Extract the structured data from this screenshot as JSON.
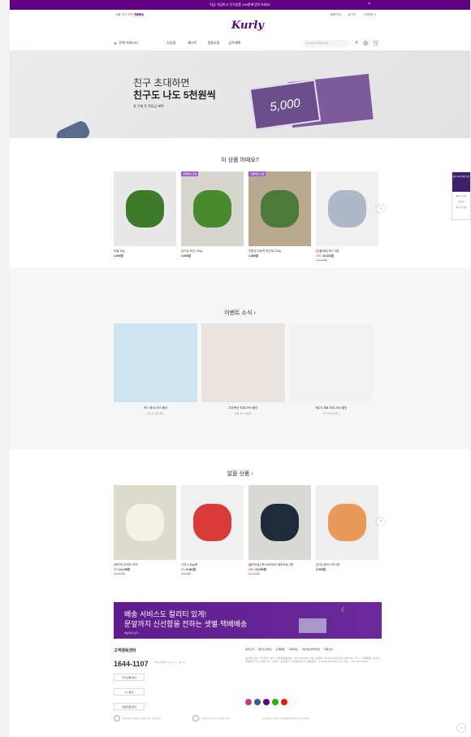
{
  "topbar": {
    "text": "지금 가입하고 인기상품 100원에 받아가세요!",
    "close": "×"
  },
  "util": {
    "delivery_prefix": "서울·경기 지역",
    "delivery_link": "샛별배송",
    "links": [
      "회원가입",
      "로그인",
      "고객센터 ▾"
    ]
  },
  "logo": "Kurly",
  "gnb": {
    "category_label": "전체 카테고리",
    "menu": [
      "신상품",
      "베스트",
      "알뜰쇼핑",
      "금주혜택"
    ],
    "search_placeholder": "검색어를 입력해주세요"
  },
  "hero": {
    "line1": "친구 초대하면",
    "line2": "친구도 나도 5천원씩",
    "line3": "첫 구매 후 적립금 혜택",
    "card_value": "5,000"
  },
  "section_recommend": {
    "title": "이 상품 어때요?",
    "products": [
      {
        "name": "바질 10g",
        "price": "1,800원",
        "badge": "",
        "discount": "",
        "original": "",
        "color": "#e8e8e8",
        "leaf": "#3f7a2a"
      },
      {
        "name": "유기농 쑥갓 100g",
        "price": "2,900원",
        "badge": "샛별배송 전용",
        "discount": "",
        "original": "",
        "color": "#d6d6cf",
        "leaf": "#4a8a2f"
      },
      {
        "name": "친환경 무농약 적근대 100g",
        "price": "1,800원",
        "badge": "샛별배송 전용",
        "discount": "",
        "original": "",
        "color": "#b9a98f",
        "leaf": "#4c7a3a"
      },
      {
        "name": "[선물세트] 푸드 3종",
        "price": "16,320원",
        "badge": "",
        "discount": "20%",
        "original": "20,400원",
        "color": "#f0f0f0",
        "leaf": "#b0b7c8"
      }
    ],
    "next": "›"
  },
  "section_event": {
    "title": "이벤트 소식 ›",
    "events": [
      {
        "name": "박스 최대 15% 할인",
        "sub": "이번 주 한정 특가",
        "color": "#cfe3f0"
      },
      {
        "name": "우리축산 최대 25% 할인",
        "sub": "정육 특가 이벤트",
        "color": "#e9e4df"
      },
      {
        "name": "이유식 재료 최대 25% 할인",
        "sub": "아기 이유식 특가",
        "color": "#f2f2f2"
      }
    ]
  },
  "section_deal": {
    "title": "알뜰 상품 ›",
    "products": [
      {
        "name": "[케이브] 무라타 치즈",
        "price": "14,155원",
        "badge": "",
        "discount": "5%",
        "original": "14,900원",
        "color": "#dcdccd",
        "leaf": "#f4f1e6"
      },
      {
        "name": "사과 1.2kg/봉",
        "price": "9,461원",
        "badge": "",
        "discount": "3%",
        "original": "9,900원",
        "color": "#f0f0f0",
        "leaf": "#d93a3a"
      },
      {
        "name": "[올리브유] 엑스트라버진 올리브유 2종",
        "price": "15,350원",
        "badge": "",
        "discount": "39%",
        "original": "25,000원",
        "color": "#d8d8d4",
        "leaf": "#1f2a3a"
      },
      {
        "name": "[간식] 현미 스틱 2종",
        "price": "3,900원",
        "badge": "",
        "discount": "",
        "original": "",
        "color": "#eeeeee",
        "leaf": "#e89a5a"
      }
    ],
    "next": "›"
  },
  "banner": {
    "line1": "배송 서비스도 컬리티 있게!",
    "line2": "문앞까지 신선함을 전하는 샛별·택배배송",
    "link": "배송안내 보기"
  },
  "footer": {
    "cs_title": "고객행복센터",
    "phone": "1644-1107",
    "cs_hours": "365고객센터 오전 7시 - 오후 7시",
    "buttons": [
      "카카오톡 문의",
      "1:1 문의",
      "대량주문 문의"
    ],
    "links": [
      "컬리소개",
      "컬리소개영상",
      "인재채용",
      "이용약관",
      "개인정보처리방침",
      "이용안내"
    ],
    "info": "법인명(상호) : 주식회사 컬리 | 사업자등록번호 : 261-81-23567 | 통신판매업 : 제 2018-서울강남-01646 호 | 주소 : 서울특별시 강남구 테헤란로 133 | 대표이사 : 김슬아 | 입점문의 : 입점문의하기 | 채용문의 : recruit@kurlycorp.com | 팩스 : 070-7500-6098"
  },
  "certs": [
    "[인증범위] 마켓컬리 쇼핑몰 서비스 개발·운영",
    "개인정보보호 우수 웹사이트 인증",
    "payments 고객님은 안전거래를 위해 현금 등으로 결제시"
  ],
  "sticky": {
    "top": "컬리 최대 혜택 모음",
    "items": [
      "배송지 등록",
      "레시피",
      "최근 본 상품"
    ]
  },
  "totop": "↑"
}
